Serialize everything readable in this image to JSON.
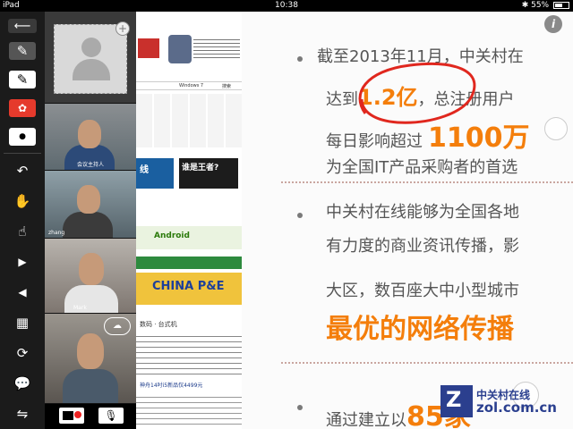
{
  "status_bar": {
    "device": "iPad",
    "time": "10:38",
    "battery": "55%"
  },
  "toolbar": {
    "items": [
      {
        "icon": "back-arrow-icon",
        "glyph": "⟵"
      },
      {
        "icon": "pencil-icon",
        "glyph": "✎"
      },
      {
        "icon": "pen-icon",
        "glyph": "✎"
      },
      {
        "icon": "palette-icon",
        "glyph": "🎨"
      },
      {
        "icon": "dot-icon",
        "glyph": "●"
      },
      {
        "icon": "undo-icon",
        "glyph": "↶"
      },
      {
        "icon": "hand-icon",
        "glyph": "✋"
      },
      {
        "icon": "pointer-hand-icon",
        "glyph": "☝"
      },
      {
        "icon": "play-next-icon",
        "glyph": "▶"
      },
      {
        "icon": "play-prev-icon",
        "glyph": "◀"
      },
      {
        "icon": "grid-icon",
        "glyph": "▦"
      },
      {
        "icon": "camera-switch-icon",
        "glyph": "⟳"
      },
      {
        "icon": "chat-bubble-icon",
        "glyph": "💬"
      },
      {
        "icon": "rotate-screen-icon",
        "glyph": "⇋"
      }
    ]
  },
  "videos": {
    "labels": [
      "会议主持人",
      "zhang",
      "Mark",
      ""
    ]
  },
  "bottom_bar": {
    "camera_icon": "video-off-icon",
    "mic_icon": "microphone-icon"
  },
  "webpage": {
    "search_tab": "Windows 7",
    "search_btn": "搜索",
    "headline_1": "谁是王者?",
    "ad_1": "Android",
    "ad_2": "CHINA P&E",
    "news_1": "数码 · 台式机",
    "news_2": "神舟14吋i5新品仅4499元"
  },
  "slide": {
    "info_icon": "i",
    "line1": "截至2013年11月，中关村在",
    "line2_a": "达到",
    "line2_b": "1.2亿",
    "line2_c": "，总注册用户",
    "line3_a": "每日影响超过",
    "line3_b": "1100万",
    "line4": "为全国IT产品采购者的首选",
    "line5": "中关村在线能够为全国各地",
    "line6": "有力度的商业资讯传播，影",
    "line7": "大区，数百座大中小型城市",
    "line8": "最优的网络传播",
    "line9_a": "通过建立以",
    "line9_b": "85家",
    "watermark_cn": "中关村在线",
    "watermark_url": "zol.com.cn"
  }
}
